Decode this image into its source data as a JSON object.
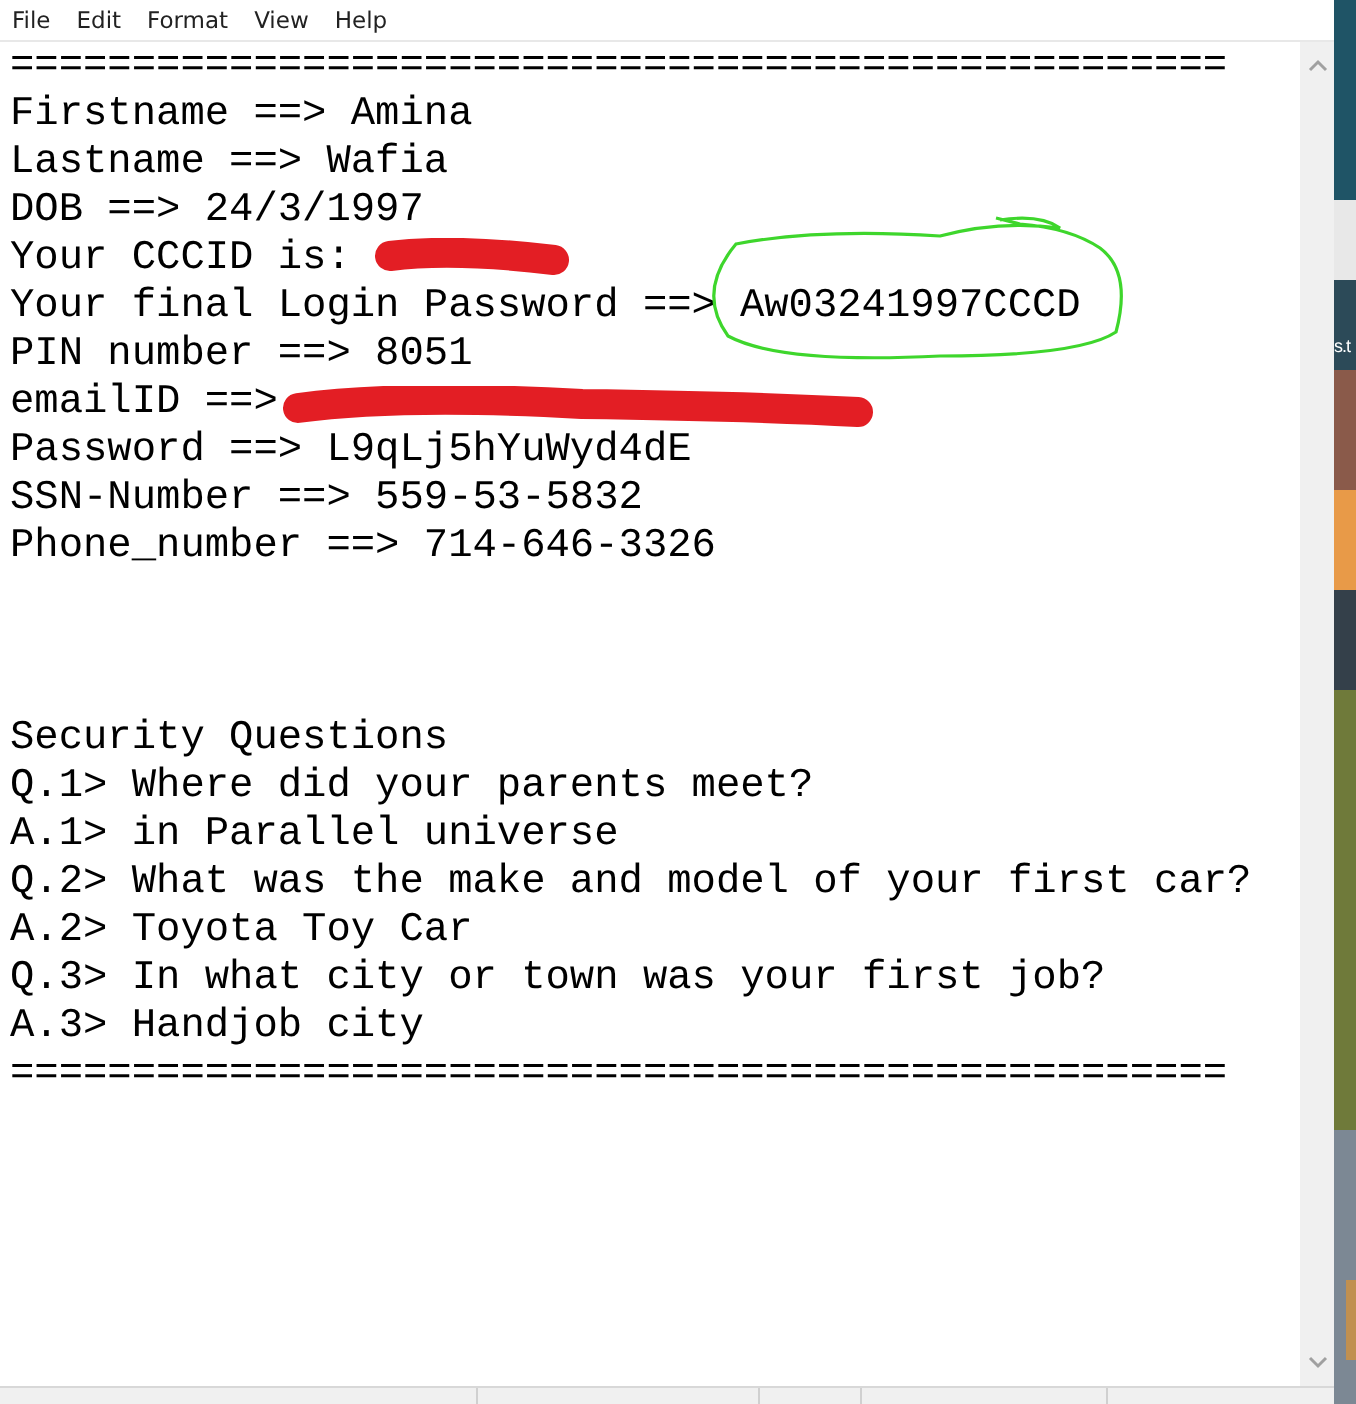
{
  "menu": [
    "File",
    "Edit",
    "Format",
    "View",
    "Help"
  ],
  "sections": [
    {
      "lines": [
        {
          "kind": "rule",
          "text": "=================================================="
        },
        {
          "kind": "plain",
          "text": "Firstname ==> Amina"
        },
        {
          "kind": "plain",
          "text": "Lastname ==> Wafia"
        },
        {
          "kind": "plain",
          "text": "DOB ==> 24/3/1997"
        },
        {
          "kind": "redacted",
          "text": "Your CCCID is:"
        },
        {
          "kind": "circled",
          "text": "Your final Login Password ==>",
          "value": "Aw03241997CCCD"
        },
        {
          "kind": "plain",
          "text": "PIN number ==> 8051"
        },
        {
          "kind": "covered",
          "text": "emailID ==>"
        },
        {
          "kind": "plain",
          "text": "Password ==> L9qLj5hYuWyd4dE"
        },
        {
          "kind": "plain",
          "text": "SSN-Number ==> 559-53-5832"
        },
        {
          "kind": "plain",
          "text": "Phone_number ==> 714-646-3326"
        }
      ]
    },
    {
      "lines": [
        {
          "kind": "plain",
          "text": "Security Questions"
        },
        {
          "kind": "plain",
          "text": "Q.1> Where did your parents meet?"
        },
        {
          "kind": "plain",
          "text": "A.1> in Parallel universe"
        },
        {
          "kind": "plain",
          "text": "Q.2> What was the make and model of your first car?"
        },
        {
          "kind": "plain",
          "text": "A.2> Toyota Toy Car"
        },
        {
          "kind": "plain",
          "text": "Q.3> In what city or town was your first job?"
        },
        {
          "kind": "plain",
          "text": "A.3> Handjob city"
        },
        {
          "kind": "rule",
          "text": "=================================================="
        }
      ]
    }
  ],
  "desktop": {
    "icon_label": "s.t"
  }
}
